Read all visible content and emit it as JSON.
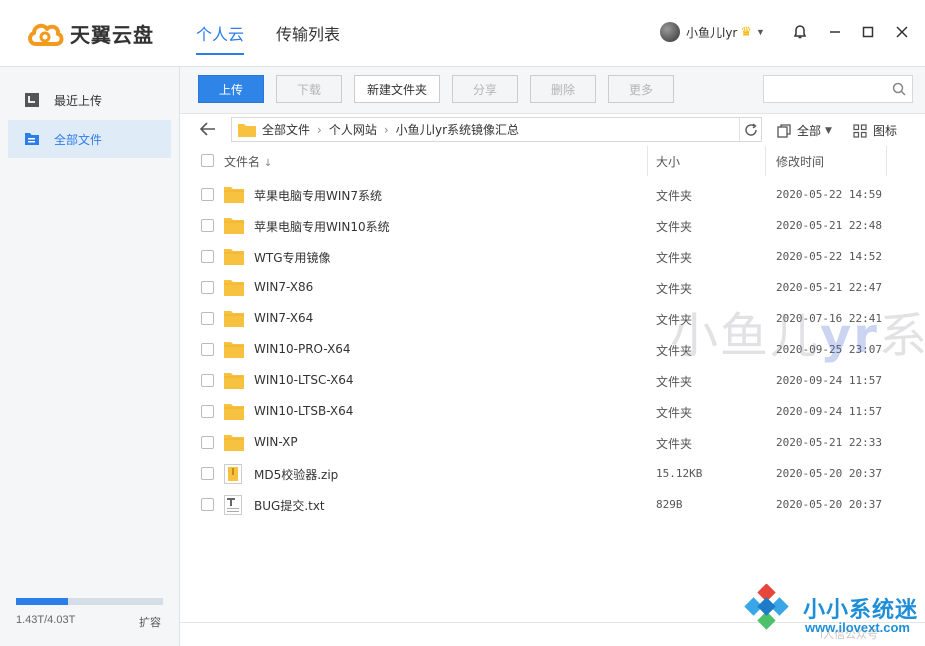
{
  "app": {
    "brand": "天翼云盘",
    "nav_tabs": [
      {
        "label": "个人云",
        "active": true
      },
      {
        "label": "传输列表",
        "active": false
      }
    ],
    "username": "小鱼儿lyr",
    "accent_color": "#2b7de9"
  },
  "sidebar": {
    "items": [
      {
        "label": "最近上传",
        "icon": "recent-upload-icon",
        "active": false
      },
      {
        "label": "全部文件",
        "icon": "all-files-icon",
        "active": true
      }
    ],
    "quota": {
      "text": "1.43T/4.03T",
      "fraction": 0.355,
      "expand_label": "扩容"
    }
  },
  "toolbar": {
    "upload": "上传",
    "download": "下载",
    "new_folder": "新建文件夹",
    "share": "分享",
    "delete": "删除",
    "more": "更多",
    "search_placeholder": ""
  },
  "path": {
    "crumbs": [
      "全部文件",
      "个人网站",
      "小鱼儿lyr系统镜像汇总"
    ],
    "filter_label": "全部",
    "view_label": "图标"
  },
  "table": {
    "headers": {
      "name": "文件名",
      "size": "大小",
      "modified": "修改时间"
    },
    "rows": [
      {
        "name": "苹果电脑专用WIN7系统",
        "type": "folder",
        "size": "文件夹",
        "modified": "2020-05-22 14:59"
      },
      {
        "name": "苹果电脑专用WIN10系统",
        "type": "folder",
        "size": "文件夹",
        "modified": "2020-05-21 22:48"
      },
      {
        "name": "WTG专用镜像",
        "type": "folder",
        "size": "文件夹",
        "modified": "2020-05-22 14:52"
      },
      {
        "name": "WIN7-X86",
        "type": "folder",
        "size": "文件夹",
        "modified": "2020-05-21 22:47"
      },
      {
        "name": "WIN7-X64",
        "type": "folder",
        "size": "文件夹",
        "modified": "2020-07-16 22:41"
      },
      {
        "name": "WIN10-PRO-X64",
        "type": "folder",
        "size": "文件夹",
        "modified": "2020-09-25 23:07"
      },
      {
        "name": "WIN10-LTSC-X64",
        "type": "folder",
        "size": "文件夹",
        "modified": "2020-09-24 11:57"
      },
      {
        "name": "WIN10-LTSB-X64",
        "type": "folder",
        "size": "文件夹",
        "modified": "2020-09-24 11:57"
      },
      {
        "name": "WIN-XP",
        "type": "folder",
        "size": "文件夹",
        "modified": "2020-05-21 22:33"
      },
      {
        "name": "MD5校验器.zip",
        "type": "zip",
        "size": "15.12KB",
        "modified": "2020-05-20 20:37"
      },
      {
        "name": "BUG提交.txt",
        "type": "txt",
        "size": "829B",
        "modified": "2020-05-20 20:37"
      }
    ]
  },
  "watermark": {
    "overlay_prefix": "小鱼儿",
    "overlay_bold": "yr",
    "overlay_suffix": "系统",
    "site_title": "小小系统迷",
    "site_url": "www.ilovext.com",
    "site_sub": "i人信公众号"
  }
}
